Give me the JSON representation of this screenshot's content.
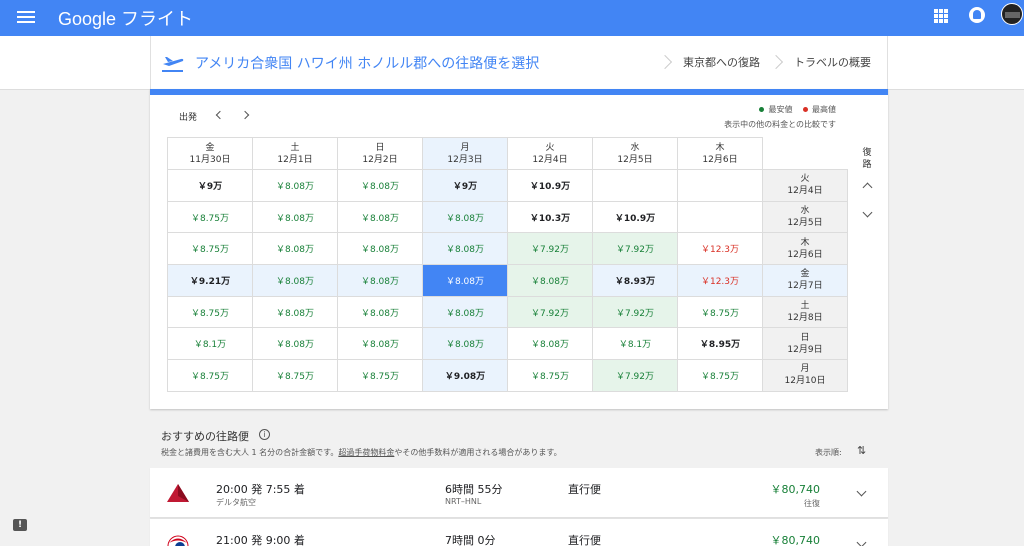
{
  "app": {
    "brand": "Google フライト"
  },
  "header": {
    "title": "アメリカ合衆国 ハワイ州 ホノルル郡への往路便を選択",
    "crumb_return": "東京都への復路",
    "crumb_summary": "トラベルの概要"
  },
  "calendar": {
    "depart_label": "出発",
    "return_label": "復路",
    "legend_low": "最安値",
    "legend_high": "最高値",
    "legend_note": "表示中の他の料金との比較です",
    "colors": {
      "low": "#188038",
      "high": "#d93025",
      "accent": "#4285f4"
    },
    "columns": [
      {
        "dow": "金",
        "date": "11月30日"
      },
      {
        "dow": "土",
        "date": "12月1日"
      },
      {
        "dow": "日",
        "date": "12月2日"
      },
      {
        "dow": "月",
        "date": "12月3日"
      },
      {
        "dow": "火",
        "date": "12月4日"
      },
      {
        "dow": "水",
        "date": "12月5日"
      },
      {
        "dow": "木",
        "date": "12月6日"
      }
    ],
    "rows": [
      {
        "dow": "火",
        "date": "12月4日",
        "cells": [
          "￥9万",
          "￥8.08万",
          "￥8.08万",
          "￥9万",
          "￥10.9万",
          "",
          ""
        ]
      },
      {
        "dow": "水",
        "date": "12月5日",
        "cells": [
          "￥8.75万",
          "￥8.08万",
          "￥8.08万",
          "￥8.08万",
          "￥10.3万",
          "￥10.9万",
          ""
        ]
      },
      {
        "dow": "木",
        "date": "12月6日",
        "cells": [
          "￥8.75万",
          "￥8.08万",
          "￥8.08万",
          "￥8.08万",
          "￥7.92万",
          "￥7.92万",
          "￥12.3万"
        ]
      },
      {
        "dow": "金",
        "date": "12月7日",
        "cells": [
          "￥9.21万",
          "￥8.08万",
          "￥8.08万",
          "￥8.08万",
          "￥8.08万",
          "￥8.93万",
          "￥12.3万"
        ]
      },
      {
        "dow": "土",
        "date": "12月8日",
        "cells": [
          "￥8.75万",
          "￥8.08万",
          "￥8.08万",
          "￥8.08万",
          "￥7.92万",
          "￥7.92万",
          "￥8.75万"
        ]
      },
      {
        "dow": "日",
        "date": "12月9日",
        "cells": [
          "￥8.1万",
          "￥8.08万",
          "￥8.08万",
          "￥8.08万",
          "￥8.08万",
          "￥8.1万",
          "￥8.95万"
        ]
      },
      {
        "dow": "月",
        "date": "12月10日",
        "cells": [
          "￥8.75万",
          "￥8.75万",
          "￥8.75万",
          "￥9.08万",
          "￥8.75万",
          "￥7.92万",
          "￥8.75万"
        ]
      }
    ]
  },
  "results": {
    "title": "おすすめの往路便",
    "sub_before": "税金と諸費用を含む大人 1 名分の合計金額です。",
    "sub_link": "超過手荷物料金",
    "sub_after": "やその他手数料が適用される場合があります。",
    "sort_label": "表示順:",
    "flights": [
      {
        "time": "20:00 発 7:55 着",
        "airline": "デルタ航空",
        "duration": "6時間 55分",
        "route": "NRT–HNL",
        "stops": "直行便",
        "price": "￥80,740",
        "price_type": "往復"
      },
      {
        "time": "21:00 発 9:00 着",
        "airline": "",
        "duration": "7時間 0分",
        "route": "",
        "stops": "直行便",
        "price": "￥80,740",
        "price_type": ""
      }
    ]
  }
}
